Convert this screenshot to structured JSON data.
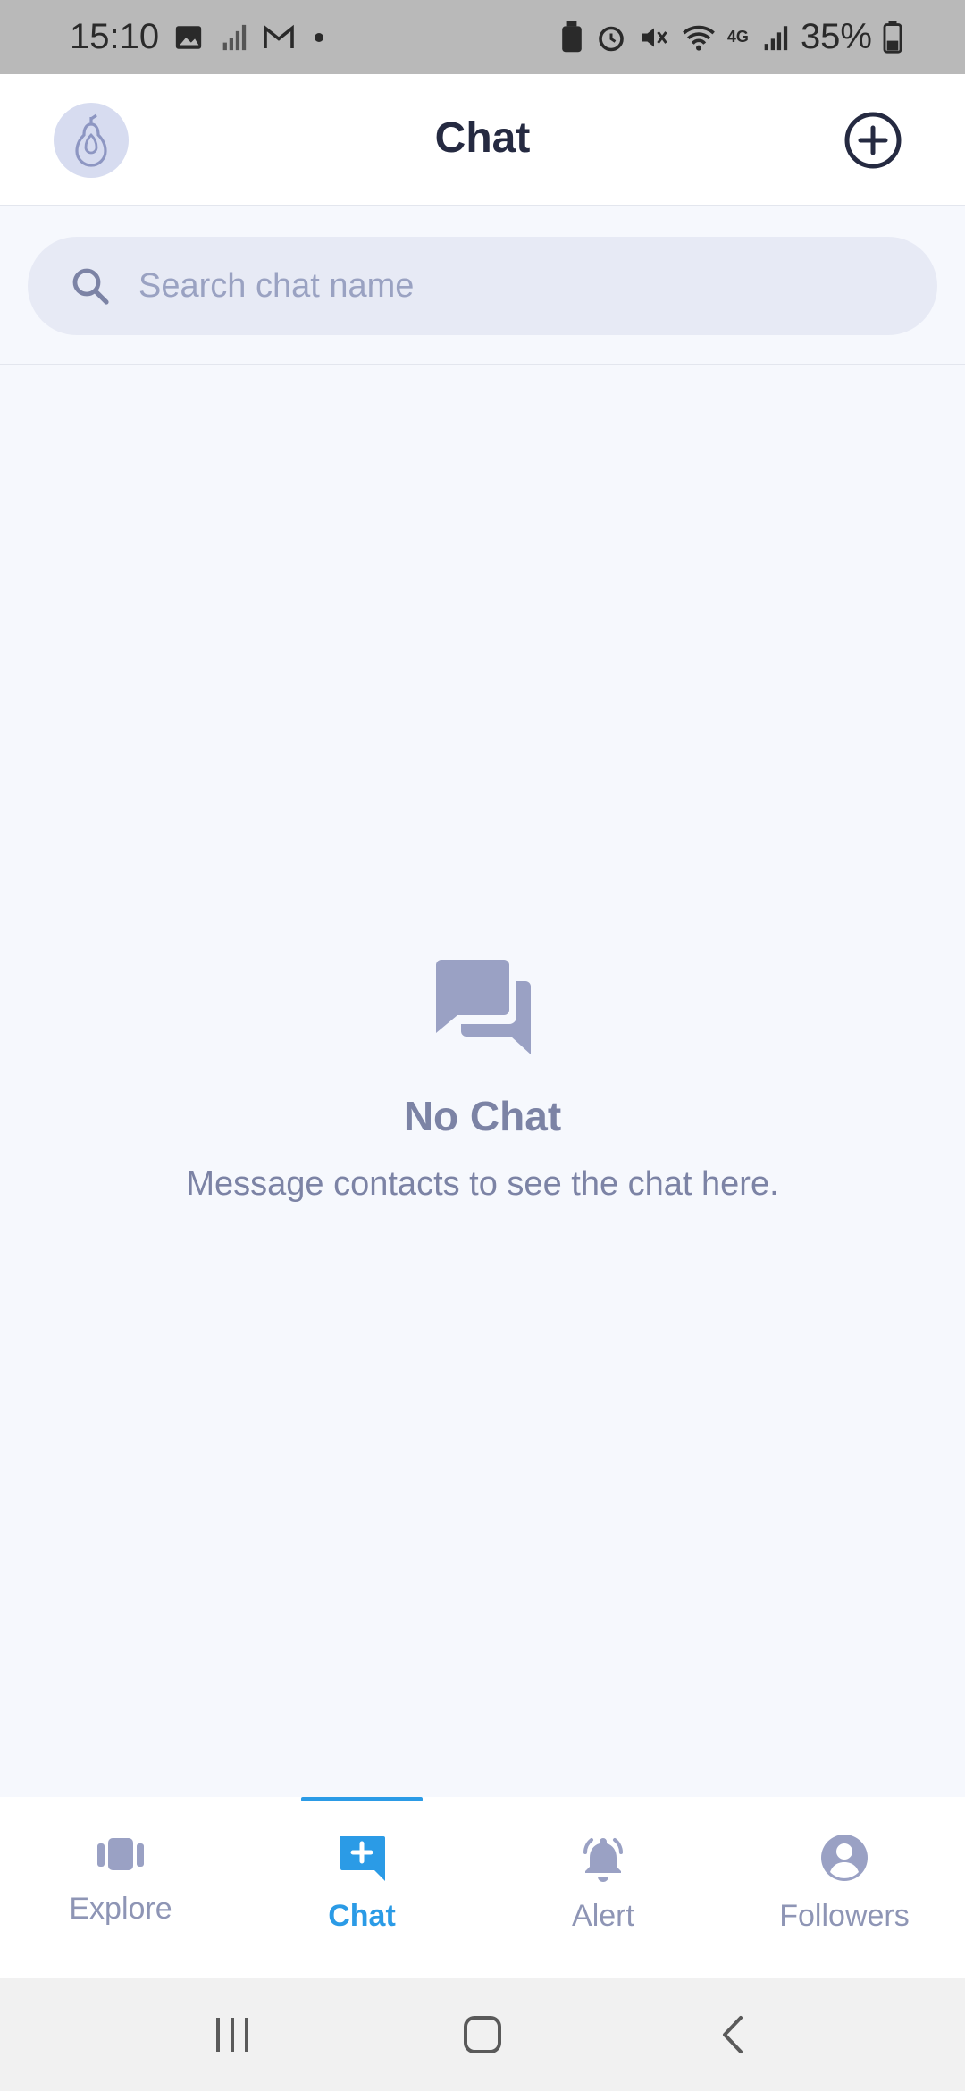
{
  "status_bar": {
    "time": "15:10",
    "battery": "35%",
    "network": "4G"
  },
  "header": {
    "title": "Chat"
  },
  "search": {
    "placeholder": "Search chat name",
    "value": ""
  },
  "empty_state": {
    "title": "No Chat",
    "subtitle": "Message contacts to see the chat here."
  },
  "bottom_nav": {
    "items": [
      {
        "label": "Explore",
        "icon": "explore-icon",
        "active": false
      },
      {
        "label": "Chat",
        "icon": "chat-add-icon",
        "active": true
      },
      {
        "label": "Alert",
        "icon": "bell-icon",
        "active": false
      },
      {
        "label": "Followers",
        "icon": "user-circle-icon",
        "active": false
      }
    ]
  },
  "colors": {
    "accent": "#2b9be6",
    "muted": "#8e95b5",
    "title": "#252a41",
    "background": "#f6f8fd"
  }
}
